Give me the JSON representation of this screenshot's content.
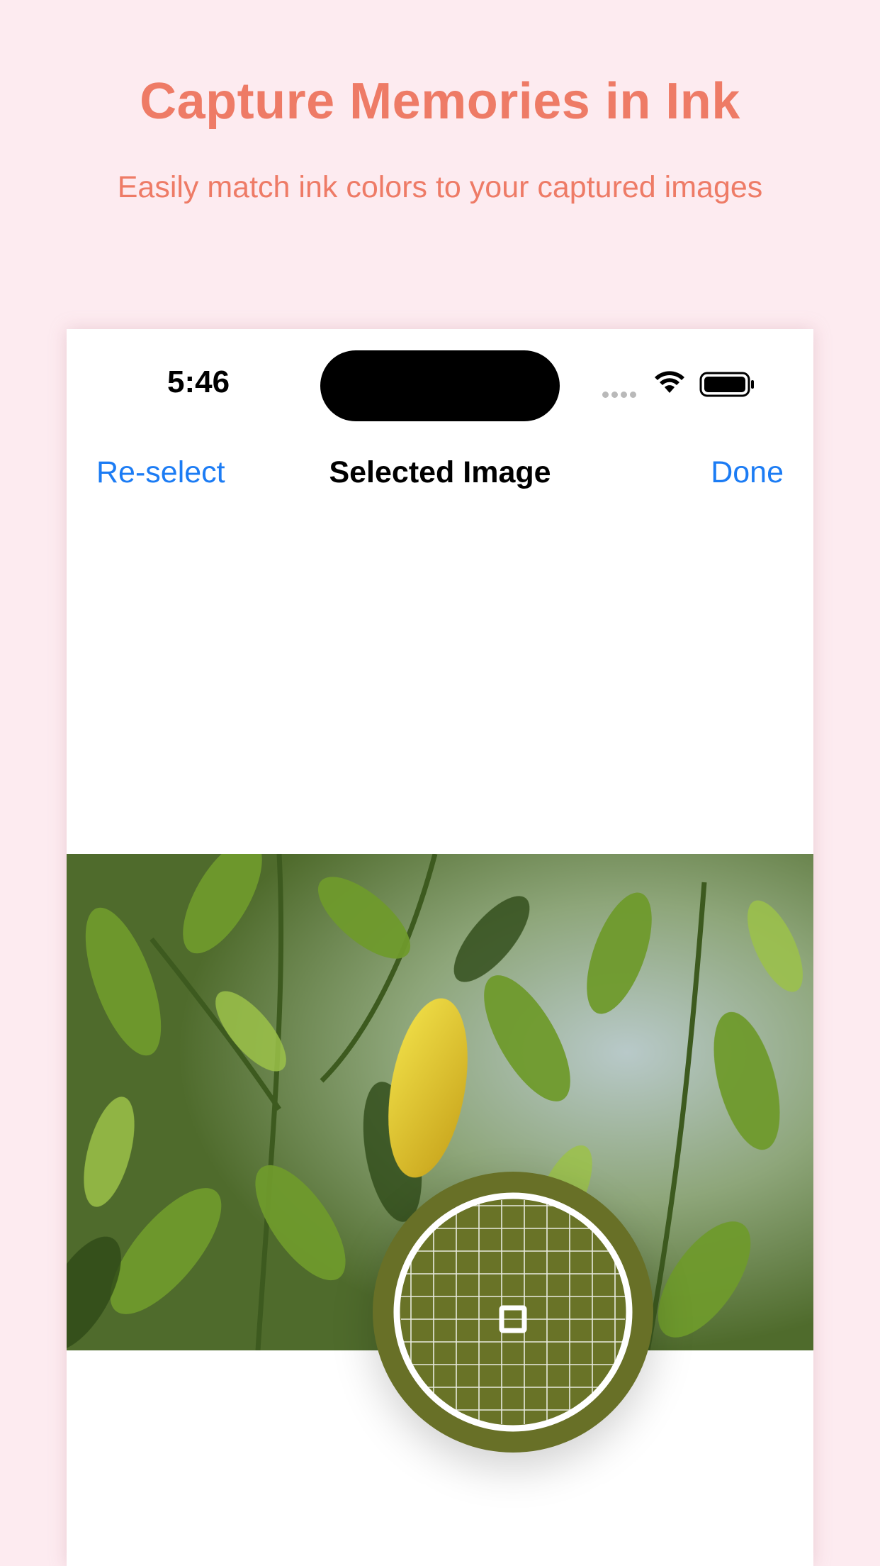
{
  "header": {
    "title": "Capture Memories in Ink",
    "subtitle": "Easily match ink colors to your captured images"
  },
  "status_bar": {
    "time": "5:46",
    "icons": [
      "signal-dots-icon",
      "wifi-icon",
      "battery-icon"
    ]
  },
  "nav": {
    "left_label": "Re-select",
    "title": "Selected Image",
    "right_label": "Done"
  },
  "loupe": {
    "sampled_color": "#687027",
    "icon": "color-picker-loupe-icon"
  },
  "colors": {
    "background": "#fdebf0",
    "accent": "#ee7b66",
    "link": "#1c7cf4"
  }
}
